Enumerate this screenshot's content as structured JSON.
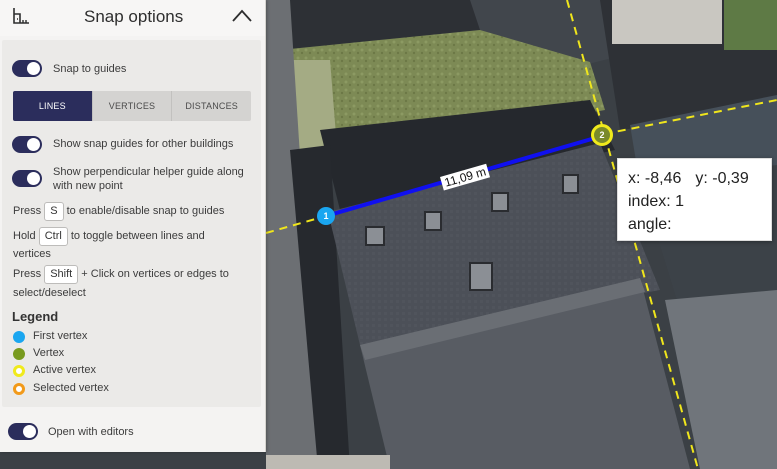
{
  "panel": {
    "title": "Snap options",
    "snap_to_guides_label": "Snap to guides",
    "snap_to_guides_on": true,
    "tabs": [
      {
        "label": "LINES",
        "active": true
      },
      {
        "label": "VERTICES",
        "active": false
      },
      {
        "label": "DISTANCES",
        "active": false
      }
    ],
    "show_guides_other_label": "Show snap guides for other buildings",
    "show_perp_label": "Show perpendicular helper guide along with new point",
    "shortcut_s": {
      "pre": "Press",
      "key": "S",
      "post": "to enable/disable snap to guides"
    },
    "shortcut_ctrl": {
      "pre": "Hold",
      "key": "Ctrl",
      "post": "to toggle between lines and",
      "line2": "vertices"
    },
    "shortcut_shift": {
      "pre": "Press",
      "key": "Shift",
      "post": "+ Click on vertices or edges to",
      "line2": "select/deselect"
    },
    "legend": {
      "title": "Legend",
      "items": [
        {
          "label": "First vertex",
          "color": "#1aa6f0",
          "style": "fill"
        },
        {
          "label": "Vertex",
          "color": "#789a1e",
          "style": "fill"
        },
        {
          "label": "Active vertex",
          "color": "#f0ea1c",
          "style": "ring"
        },
        {
          "label": "Selected vertex",
          "color": "#f29a1a",
          "style": "ring"
        }
      ]
    },
    "open_with_editors_label": "Open with editors",
    "open_with_editors_on": true
  },
  "map": {
    "distance_label": "11,09 m",
    "line_color": "#1010f0",
    "guide_color": "#f0e61c",
    "vertex_1": {
      "label": "1",
      "color": "#1aa6f0"
    },
    "vertex_2": {
      "label": "2",
      "color": "#f0ea1c"
    }
  },
  "tooltip": {
    "x_label": "x: -8,46",
    "y_label": "y: -0,39",
    "index_label": "index: 1",
    "angle_label": "angle:"
  },
  "colors": {
    "accent": "#2b2d5c",
    "panel_bg": "#f4f3f2"
  }
}
